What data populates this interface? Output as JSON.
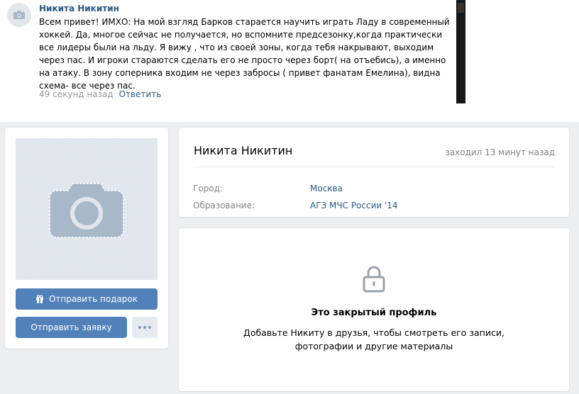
{
  "comment": {
    "author": "Никита Никитин",
    "text_lines": [
      "Всем привет! ИМХО: На мой взгляд Барков старается научить играть Ладу в современный",
      "хоккей. Да, многое сейчас не получается, но вспомните предсезонку,когда практически",
      "все лидеры были на льду. Я вижу , что из своей зоны, когда тебя накрывают, выходим",
      "через пас. И игроки стараются сделать его не просто через борт( на отъебись), а именно",
      "на атаку. В зону соперника входим не через забросы ( привет фанатам Емелина), видна",
      "схема- все через пас."
    ],
    "time": "49 секунд назад",
    "reply": "Ответить"
  },
  "profile": {
    "name": "Никита Никитин",
    "last_seen": "заходил 13 минут назад",
    "info": [
      {
        "label": "Город:",
        "value": "Москва"
      },
      {
        "label": "Образование:",
        "value": "АГЗ МЧС России '14"
      }
    ],
    "buttons": {
      "gift": "Отправить подарок",
      "request": "Отправить заявку"
    },
    "private": {
      "title": "Это закрытый профиль",
      "desc_lines": [
        "Добавьте Никиту в друзья, чтобы смотреть его записи,",
        "фотографии и другие материалы"
      ]
    }
  },
  "icons": {
    "avatar_placeholder": "camera-icon",
    "gift": "gift-icon",
    "more": "more-dots-icon",
    "lock": "lock-icon"
  },
  "colors": {
    "link": "#2a5885",
    "button": "#5181b8",
    "button_secondary": "#e5ebf1",
    "page_bg": "#edeef0",
    "placeholder_bg": "#e1e6ec",
    "muted_text": "#828282"
  }
}
